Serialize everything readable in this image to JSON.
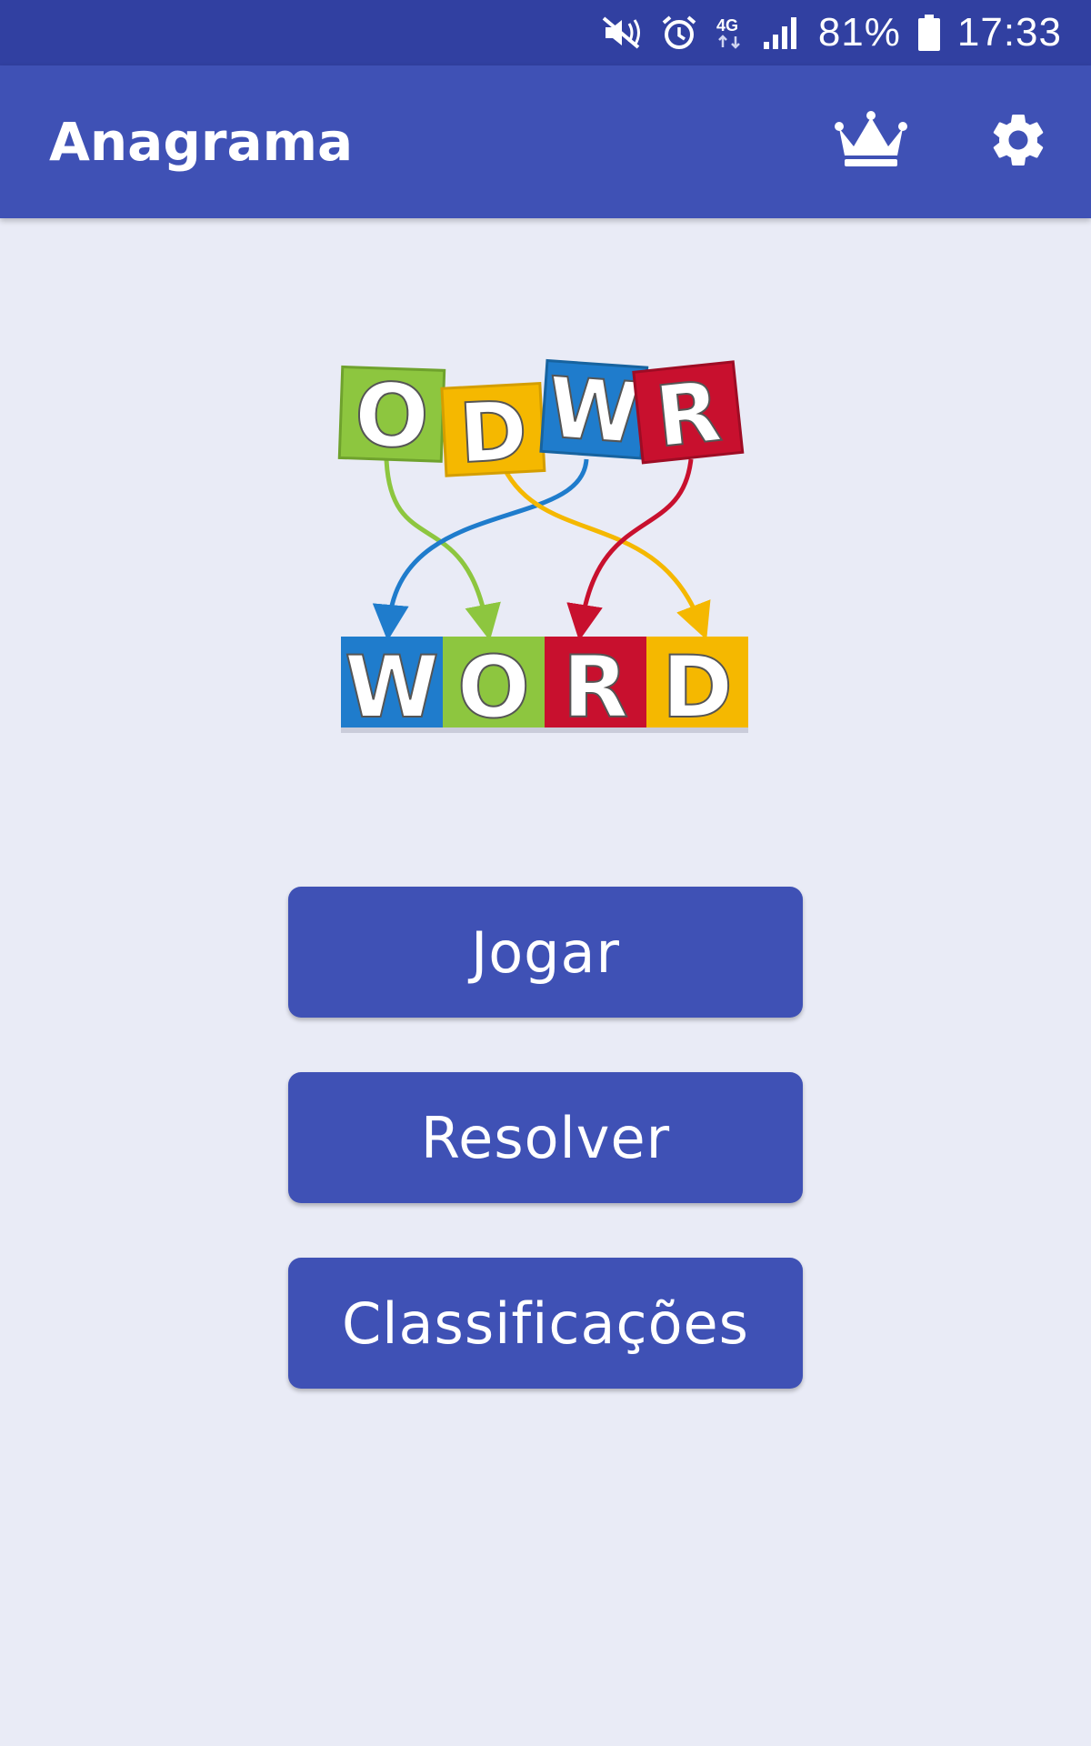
{
  "status_bar": {
    "icons": [
      "mute-icon",
      "alarm-icon",
      "network-4g-icon",
      "signal-icon"
    ],
    "battery_percent": "81%",
    "time": "17:33"
  },
  "app_bar": {
    "title": "Anagrama",
    "actions": [
      "crown-icon",
      "gear-icon"
    ]
  },
  "logo": {
    "top_letters": [
      "O",
      "D",
      "W",
      "R"
    ],
    "bottom_letters": [
      "W",
      "O",
      "R",
      "D"
    ]
  },
  "buttons": {
    "play": "Jogar",
    "solve": "Resolver",
    "rankings": "Classificações"
  },
  "colors": {
    "status_bar": "#3140a1",
    "primary": "#3f51b5",
    "background": "#e9ebf6",
    "tile_green": "#8dc63f",
    "tile_yellow": "#f5b800",
    "tile_blue": "#1f7ccc",
    "tile_red": "#c8102e"
  }
}
